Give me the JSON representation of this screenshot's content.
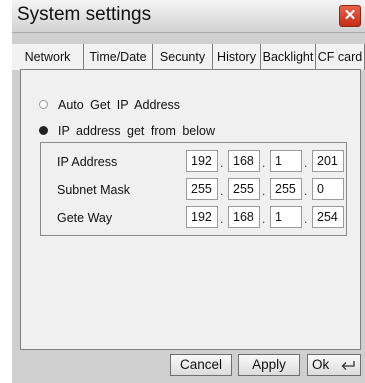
{
  "window": {
    "title": "System settings",
    "close_label": "✕"
  },
  "tabs": [
    {
      "label": "Network",
      "active": true
    },
    {
      "label": "Time/Date",
      "active": false
    },
    {
      "label": "Secunty",
      "active": false
    },
    {
      "label": "History",
      "active": false
    },
    {
      "label": "Backlight",
      "active": false
    },
    {
      "label": "CF card",
      "active": false
    }
  ],
  "network": {
    "options": [
      {
        "label": "Auto  Get IP Address",
        "selected": false
      },
      {
        "label": "IP address  get  from  below",
        "selected": true
      }
    ],
    "fields": [
      {
        "label": "IP Address",
        "octets": [
          "192",
          "168",
          "1",
          "201"
        ]
      },
      {
        "label": "Subnet Mask",
        "octets": [
          "255",
          "255",
          "255",
          "0"
        ]
      },
      {
        "label": "Gete Way",
        "octets": [
          "192",
          "168",
          "1",
          "254"
        ]
      }
    ],
    "separator": "."
  },
  "buttons": {
    "cancel": "Cancel",
    "apply": "Apply",
    "ok": "Ok"
  },
  "icons": {
    "close": "close-icon",
    "ok": "enter-arrow-icon",
    "radio_on": "radio-selected-icon",
    "radio_off": "radio-unselected-icon"
  },
  "colors": {
    "close_button": "#d9442c",
    "window_bg": "#cfcfcf",
    "panel_bg": "#f0f0f0"
  }
}
